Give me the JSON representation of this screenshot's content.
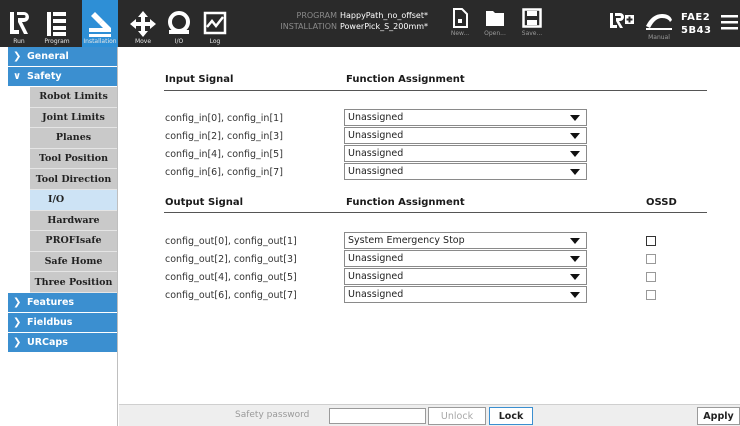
{
  "topbar": {
    "tabs": [
      {
        "label": "Run",
        "icon": "ur-logo-icon"
      },
      {
        "label": "Program",
        "icon": "program-icon"
      },
      {
        "label": "Installation",
        "icon": "installation-icon",
        "active": true
      },
      {
        "label": "Move",
        "icon": "move-icon"
      },
      {
        "label": "I/O",
        "icon": "io-icon"
      },
      {
        "label": "Log",
        "icon": "log-icon"
      }
    ],
    "program_key": "PROGRAM",
    "program_value": "HappyPath_no_offset*",
    "installation_key": "INSTALLATION",
    "installation_value": "PowerPick_S_200mm*",
    "file_buttons": [
      {
        "label": "New...",
        "icon": "new-file-icon"
      },
      {
        "label": "Open...",
        "icon": "open-folder-icon"
      },
      {
        "label": "Save...",
        "icon": "save-icon"
      }
    ],
    "mode_label": "Manual",
    "robot_name_line1": "FAE2",
    "robot_name_line2": "5B43",
    "accent_color": "#2e8fd6"
  },
  "sidebar": {
    "items": [
      {
        "label": "General",
        "type": "top",
        "expanded": false
      },
      {
        "label": "Safety",
        "type": "top",
        "expanded": true
      },
      {
        "label": "Robot Limits",
        "type": "sub"
      },
      {
        "label": "Joint Limits",
        "type": "sub"
      },
      {
        "label": "Planes",
        "type": "sub"
      },
      {
        "label": "Tool Position",
        "type": "sub"
      },
      {
        "label": "Tool Direction",
        "type": "sub"
      },
      {
        "label": "I/O",
        "type": "sub",
        "selected": true
      },
      {
        "label": "Hardware",
        "type": "sub"
      },
      {
        "label": "PROFIsafe",
        "type": "sub"
      },
      {
        "label": "Safe Home",
        "type": "sub"
      },
      {
        "label": "Three Position",
        "type": "sub"
      },
      {
        "label": "Features",
        "type": "top",
        "expanded": false
      },
      {
        "label": "Fieldbus",
        "type": "top",
        "expanded": false
      },
      {
        "label": "URCaps",
        "type": "top",
        "expanded": false
      }
    ]
  },
  "main": {
    "input_header": "Input Signal",
    "input_function_header": "Function Assignment",
    "inputs": [
      {
        "signal": "config_in[0], config_in[1]",
        "function": "Unassigned"
      },
      {
        "signal": "config_in[2], config_in[3]",
        "function": "Unassigned"
      },
      {
        "signal": "config_in[4], config_in[5]",
        "function": "Unassigned"
      },
      {
        "signal": "config_in[6], config_in[7]",
        "function": "Unassigned"
      }
    ],
    "output_header": "Output Signal",
    "output_function_header": "Function Assignment",
    "ossd_header": "OSSD",
    "outputs": [
      {
        "signal": "config_out[0], config_out[1]",
        "function": "System Emergency Stop",
        "ossd": false,
        "ossd_enabled": true
      },
      {
        "signal": "config_out[2], config_out[3]",
        "function": "Unassigned",
        "ossd": false,
        "ossd_enabled": false
      },
      {
        "signal": "config_out[4], config_out[5]",
        "function": "Unassigned",
        "ossd": false,
        "ossd_enabled": false
      },
      {
        "signal": "config_out[6], config_out[7]",
        "function": "Unassigned",
        "ossd": false,
        "ossd_enabled": false
      }
    ]
  },
  "bottombar": {
    "password_label": "Safety password",
    "password_value": "",
    "unlock_label": "Unlock",
    "lock_label": "Lock",
    "apply_label": "Apply"
  }
}
